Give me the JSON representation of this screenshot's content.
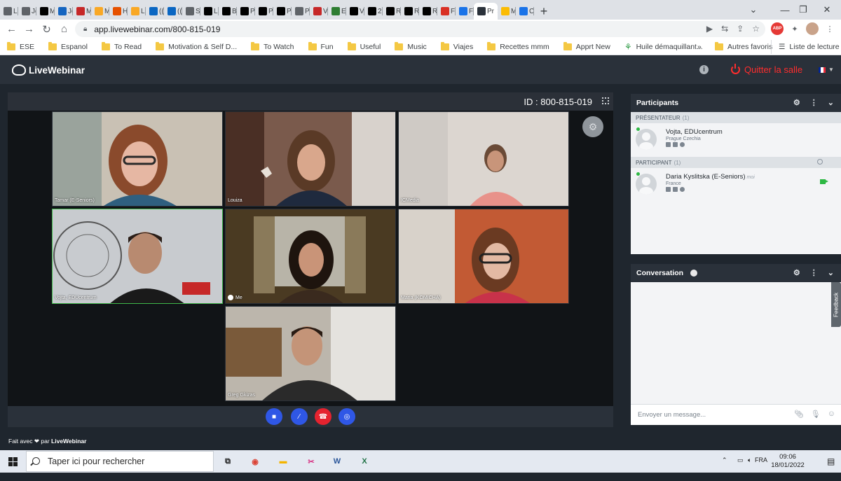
{
  "browser": {
    "tabs": [
      {
        "label": "L",
        "color": "#5f6368"
      },
      {
        "label": "Jc",
        "color": "#5f6368"
      },
      {
        "label": "M",
        "color": "#000000"
      },
      {
        "label": "Jc",
        "color": "#1565c0"
      },
      {
        "label": "M",
        "color": "#c62828"
      },
      {
        "label": "M",
        "color": "#f9a825"
      },
      {
        "label": "H",
        "color": "#e65100"
      },
      {
        "label": "L",
        "color": "#f9a825"
      },
      {
        "label": "((",
        "color": "#0a66c2"
      },
      {
        "label": "((",
        "color": "#0a66c2"
      },
      {
        "label": "S",
        "color": "#5f6368"
      },
      {
        "label": "L",
        "color": "#000000"
      },
      {
        "label": "B",
        "color": "#000000"
      },
      {
        "label": "P",
        "color": "#000000"
      },
      {
        "label": "P",
        "color": "#000000"
      },
      {
        "label": "P",
        "color": "#000000"
      },
      {
        "label": "P",
        "color": "#5f6368"
      },
      {
        "label": "V",
        "color": "#c62828"
      },
      {
        "label": "E",
        "color": "#2e7d32"
      },
      {
        "label": "V",
        "color": "#000000"
      },
      {
        "label": "2",
        "color": "#000000"
      },
      {
        "label": "R",
        "color": "#000000"
      },
      {
        "label": "R",
        "color": "#000000"
      },
      {
        "label": "R",
        "color": "#000000"
      },
      {
        "label": "F",
        "color": "#d93025"
      },
      {
        "label": "F",
        "color": "#1a73e8"
      }
    ],
    "active_tab": "Pr",
    "active_tab_close": "×",
    "after_tabs": [
      {
        "label": "M",
        "color": "#fbbc04"
      },
      {
        "label": "C",
        "color": "#1a73e8"
      }
    ],
    "new_tab": "+",
    "window_controls": {
      "dropdown": "⌄",
      "minimize": "—",
      "restore": "❐",
      "close": "✕"
    },
    "url": "app.livewebinar.com/800-815-019",
    "bookmarks": [
      "ESE",
      "Espanol",
      "To Read",
      "Motivation & Self D...",
      "To Watch",
      "Fun",
      "Useful",
      "Music",
      "Viajes",
      "Recettes mmm",
      "Apprt New"
    ],
    "bookmark_special": "Huile démaquillant...",
    "bookmark_overflow": "»",
    "other_bookmarks": "Autres favoris",
    "reading_list": "Liste de lecture",
    "extension_abp": "ABP"
  },
  "app": {
    "brand": "LiveWebinar",
    "quit_label": "Quitter la salle",
    "room_id": "ID : 800-815-019",
    "made_with_prefix": "Fait avec",
    "made_with_heart": "❤",
    "made_with_suffix": "par",
    "made_with_brand": "LiveWebinar",
    "info": "i",
    "flag_colors": [
      "#002395",
      "#ffffff",
      "#ed2939"
    ]
  },
  "videos": [
    {
      "name": "Tamar (E-Seniors)",
      "bg": "#b7a894"
    },
    {
      "name": "Louiza",
      "bg": "#6a4a3c"
    },
    {
      "name": "ICMedia",
      "bg": "#d9d2cc"
    },
    {
      "name": "Vojta, EDUcentrum",
      "bg": "#cdd0d4"
    },
    {
      "name": "Me",
      "bg": "#5c4a2e"
    },
    {
      "name": "Maria (KOMICHA)",
      "bg": "#b55a3a"
    },
    {
      "name": "Greg Gkizas",
      "bg": "#a8a39a"
    }
  ],
  "controls": [
    {
      "name": "camera-button",
      "color": "#2f57e6",
      "glyph": "■"
    },
    {
      "name": "mic-button",
      "color": "#2f57e6",
      "glyph": "⁄"
    },
    {
      "name": "hangup-button",
      "color": "#e5232f",
      "glyph": "☎"
    },
    {
      "name": "screen-button",
      "color": "#2f57e6",
      "glyph": "◎"
    }
  ],
  "participants_panel": {
    "title": "Participants",
    "presenter_section": "PRÉSENTATEUR",
    "presenter_count": "(1)",
    "presenter": {
      "name": "Vojta, EDUcentrum",
      "location": "Prague Czechia"
    },
    "participant_section": "PARTICIPANT",
    "participant_count": "(1)",
    "participant": {
      "name": "Daria Kyslitska (E-Seniors)",
      "tag": "moi",
      "location": "France"
    }
  },
  "conversation_panel": {
    "title": "Conversation",
    "placeholder": "Envoyer un message...",
    "feedback": "Feedback"
  },
  "taskbar": {
    "search_placeholder": "Taper ici pour rechercher",
    "language": "FRA",
    "time": "09:06",
    "date": "18/01/2022",
    "apps": [
      {
        "name": "task-view-icon",
        "glyph": "⧉",
        "color": "#1c1c1c"
      },
      {
        "name": "chrome-icon",
        "glyph": "◉",
        "color": "#db4437"
      },
      {
        "name": "file-explorer-icon",
        "glyph": "▬",
        "color": "#f4b400"
      },
      {
        "name": "snipping-tool-icon",
        "glyph": "✂",
        "color": "#d63384"
      },
      {
        "name": "word-icon",
        "glyph": "W",
        "color": "#2b579a"
      },
      {
        "name": "excel-icon",
        "glyph": "X",
        "color": "#217346"
      }
    ]
  }
}
